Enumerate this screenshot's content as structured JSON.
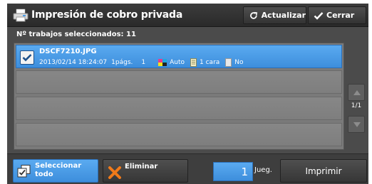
{
  "header": {
    "title": "Impresión de cobro privada",
    "refresh_label": "Actualizar",
    "close_label": "Cerrar"
  },
  "selected_count_text": "Nº trabajos seleccionados: 11",
  "jobs": [
    {
      "filename": "DSCF7210.JPG",
      "datetime": "2013/02/14 18:24:07",
      "pages": "1págs.",
      "copies": "1",
      "color_mode": "Auto",
      "sides": "1 cara",
      "staple": "No",
      "checked": true
    }
  ],
  "pager": {
    "label": "1/1"
  },
  "footer": {
    "select_all_label": "Seleccionar todo",
    "delete_label": "Eliminar",
    "quantity_value": "1",
    "quantity_unit": "Jueg.",
    "print_label": "Imprimir"
  },
  "colors": {
    "accent_blue": "#4a9be6",
    "dark_panel": "#4b4b4b",
    "row_gray": "#838383",
    "delete_x": "#f07a1a"
  },
  "icons": {
    "title": "printer-icon",
    "refresh": "refresh-icon",
    "close": "checkmark-icon",
    "color_mode": "color-palette-icon",
    "sides": "document-icon",
    "staple": "staple-icon",
    "select_all": "select-all-icon",
    "delete": "x-icon"
  }
}
